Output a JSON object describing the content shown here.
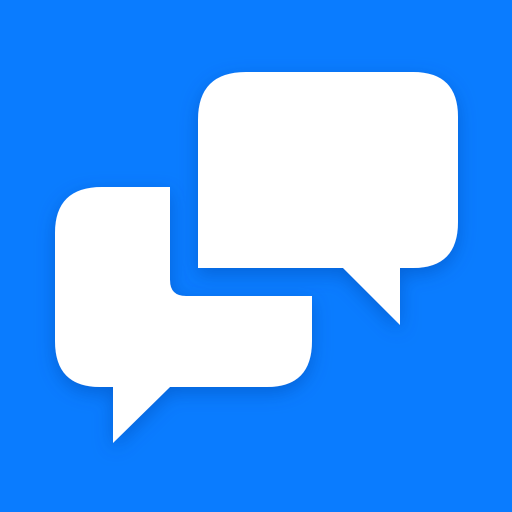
{
  "icon": {
    "name": "chat-bubbles-icon",
    "background_color": "#0A7CFF",
    "bubble_color": "#FFFFFF",
    "shadow_color": "#0550B8"
  }
}
